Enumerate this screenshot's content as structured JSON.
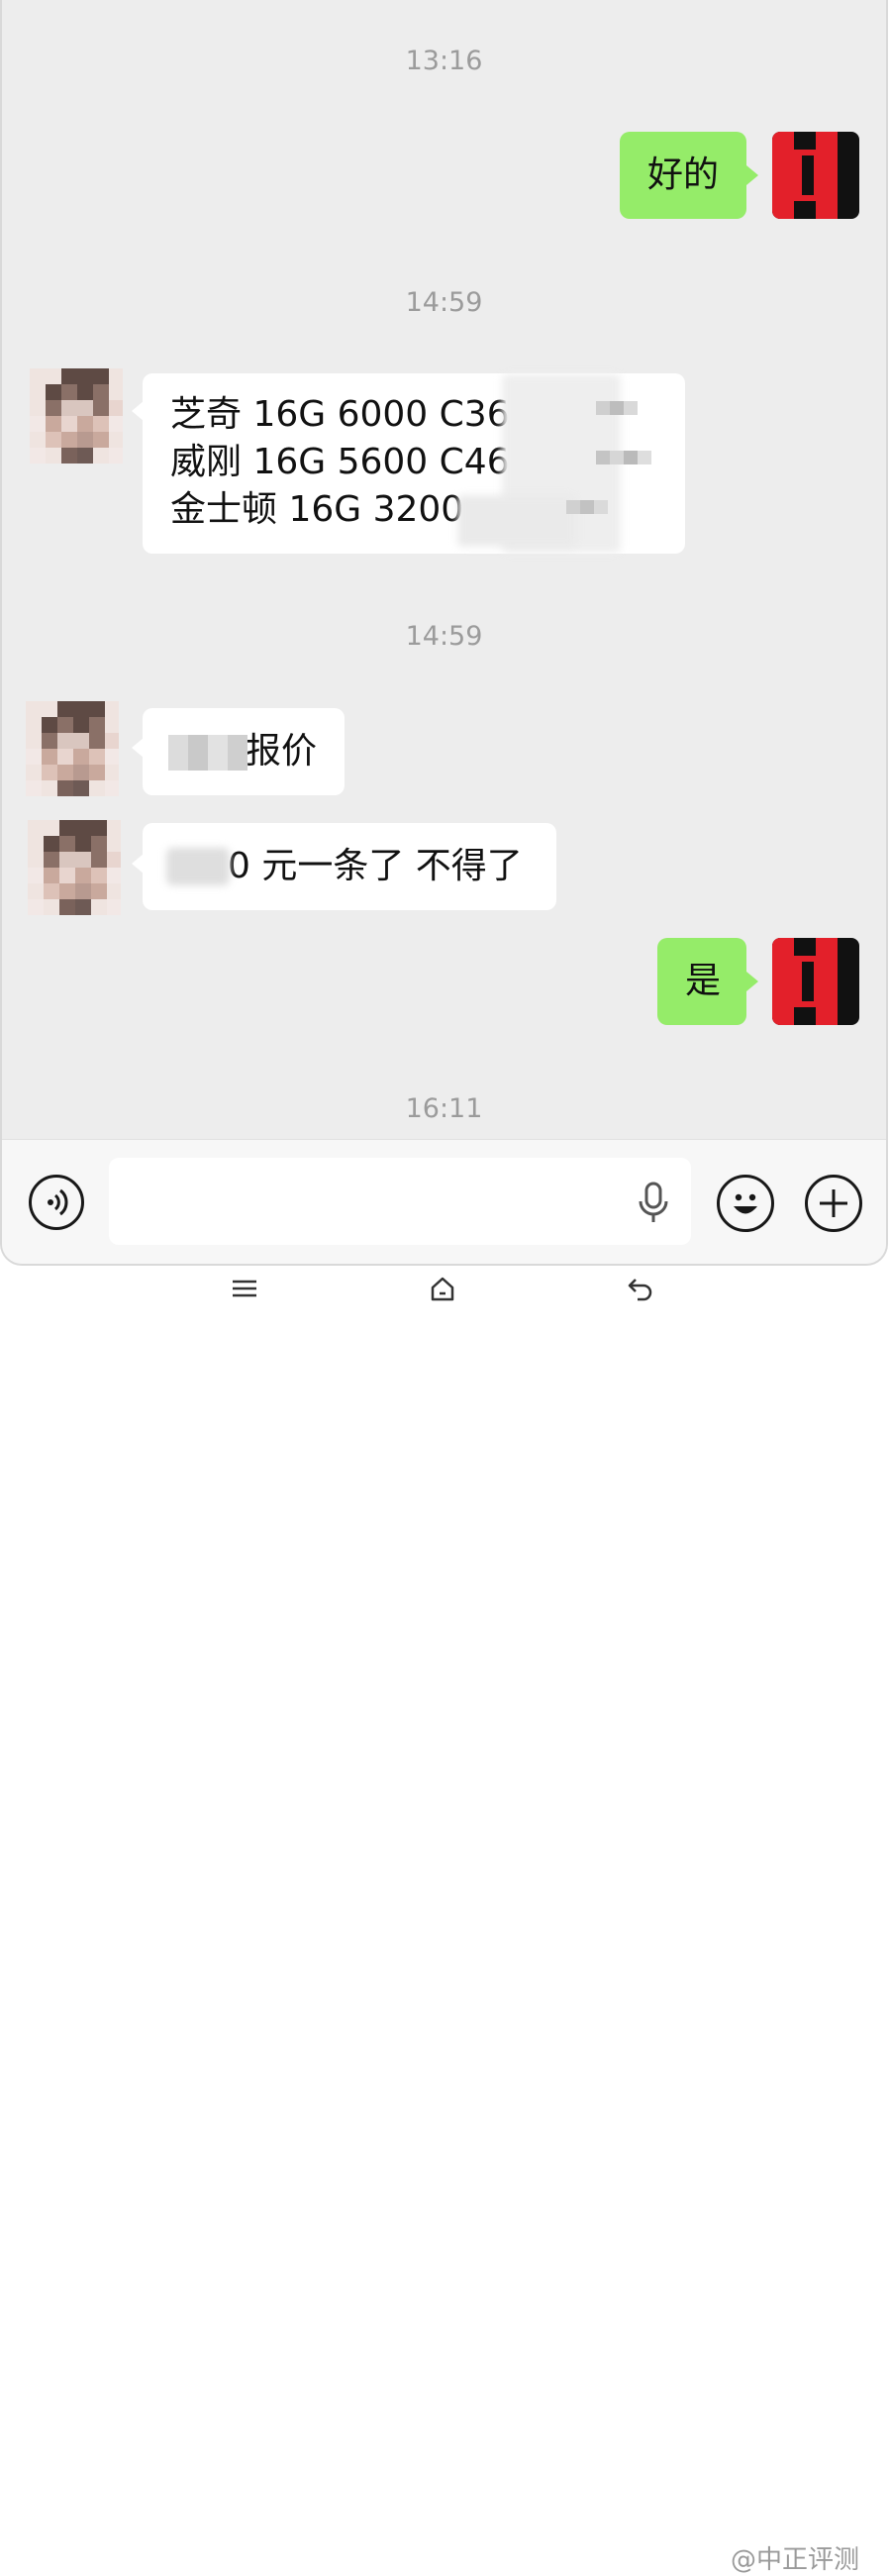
{
  "chat": {
    "timestamps": [
      "13:16",
      "14:59",
      "14:59",
      "16:11"
    ],
    "messages": [
      {
        "sender": "me",
        "text": "好的"
      },
      {
        "sender": "them",
        "lines": [
          "芝奇 16G 6000 C36",
          "威刚 16G 5600 C46",
          "金士顿 16G 3200"
        ]
      },
      {
        "sender": "them",
        "text": "报价"
      },
      {
        "sender": "them",
        "text": "0 元一条了 不得了"
      },
      {
        "sender": "me",
        "text": "是"
      }
    ]
  },
  "input_bar": {
    "voice_icon": "voice-icon",
    "mic_icon": "microphone-icon",
    "emoji_icon": "emoji-icon",
    "plus_icon": "plus-icon",
    "value": ""
  },
  "nav": {
    "menu_icon": "menu-icon",
    "home_icon": "home-icon",
    "back_icon": "back-icon"
  },
  "watermark": {
    "text": "@中正评测"
  },
  "colors": {
    "my_bubble": "#95ec69",
    "their_bubble": "#ffffff",
    "background": "#ededed",
    "brand_red": "#e3202a"
  }
}
